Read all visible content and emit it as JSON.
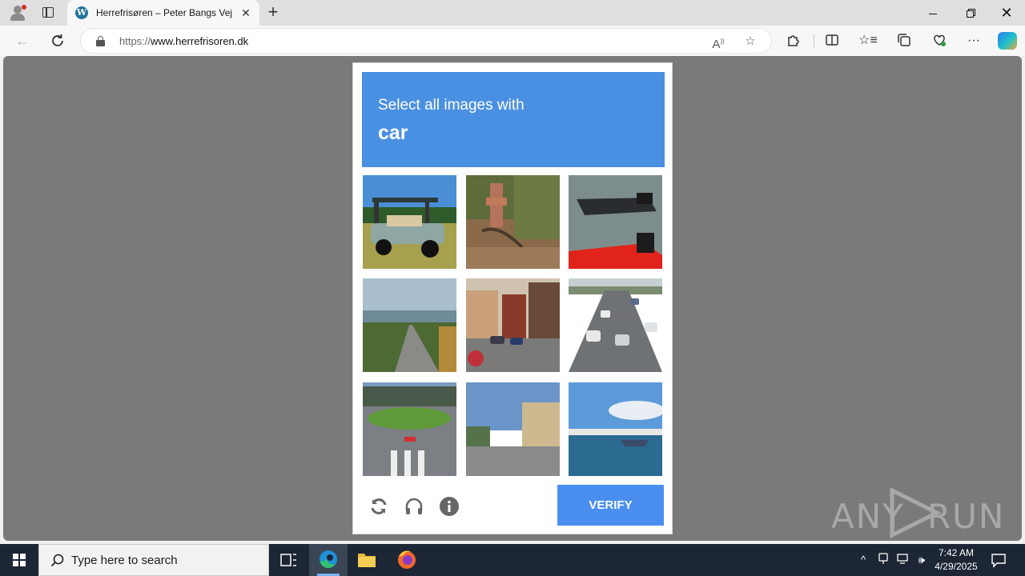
{
  "browser": {
    "tab_title": "Herrefrisøren – Peter Bangs Vej",
    "tab_favicon": "wordpress-icon",
    "new_tab_label": "+",
    "url_prefix": "https://",
    "url_host": "www.herrefrisoren.dk",
    "window_controls": [
      "minimize-icon",
      "restore-icon",
      "close-icon"
    ],
    "toolbar_icons": [
      "read-aloud-icon",
      "favorite-star-icon",
      "extensions-icon",
      "split-screen-icon",
      "favorites-icon",
      "collections-icon",
      "browser-essentials-icon",
      "more-icon",
      "copilot-icon"
    ]
  },
  "captcha": {
    "prompt": "Select all images with",
    "target": "car",
    "tiles": [
      {
        "subject": "golf cart on grass"
      },
      {
        "subject": "fire hydrant in dirt"
      },
      {
        "subject": "inflatable boats on water"
      },
      {
        "subject": "road toward a lake at dusk"
      },
      {
        "subject": "small town street with parked cars"
      },
      {
        "subject": "multi-lane highway with cars"
      },
      {
        "subject": "roundabout with crosswalk"
      },
      {
        "subject": "pedestrian street with old buildings"
      },
      {
        "subject": "boat on the sea near white cliffs"
      }
    ],
    "footer_icons": [
      "refresh-icon",
      "headphones-icon",
      "info-icon"
    ],
    "verify_label": "VERIFY",
    "header_color": "#4a90e2",
    "button_color": "#4a8ff0"
  },
  "watermark": {
    "text_left": "ANY",
    "text_right": "RUN"
  },
  "taskbar": {
    "search_placeholder": "Type here to search",
    "apps": [
      "task-view-icon",
      "edge-icon",
      "file-explorer-icon",
      "firefox-icon"
    ],
    "time": "7:42 AM",
    "date": "4/29/2025"
  }
}
